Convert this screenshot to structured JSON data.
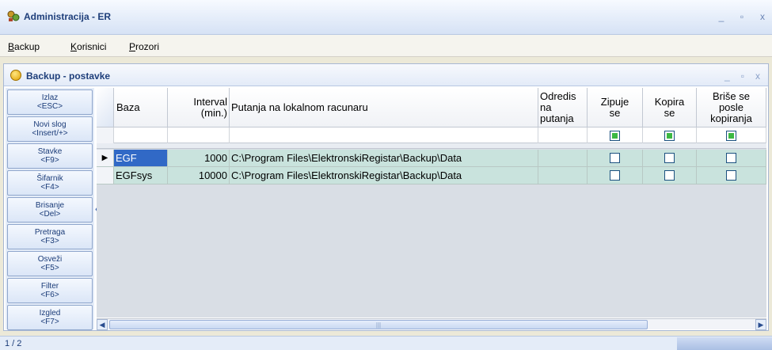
{
  "app": {
    "title": "Administracija - ER",
    "controls": {
      "minimize": "_",
      "maximize": "▫",
      "close": "x"
    }
  },
  "menu": {
    "items": [
      {
        "mnemonic": "B",
        "rest": "ackup"
      },
      {
        "mnemonic": "K",
        "rest": "orisnici"
      },
      {
        "mnemonic": "P",
        "rest": "rozori"
      }
    ]
  },
  "window": {
    "title": "Backup - postavke",
    "controls": {
      "minimize": "_",
      "maximize": "▫",
      "close": "x"
    }
  },
  "sidebar": {
    "buttons": [
      {
        "line1": "Izlaz",
        "line2": "<ESC>"
      },
      {
        "line1": "Novi slog",
        "line2": "<Insert/+>"
      },
      {
        "line1": "Stavke",
        "line2": "<F9>"
      },
      {
        "line1": "Šifarnik",
        "line2": "<F4>"
      },
      {
        "line1": "Brisanje",
        "line2": "<Del>"
      },
      {
        "line1": "Pretraga",
        "line2": "<F3>"
      },
      {
        "line1": "Osveži",
        "line2": "<F5>"
      },
      {
        "line1": "Filter",
        "line2": "<F6>"
      },
      {
        "line1": "Izgled",
        "line2": "<F7>"
      }
    ],
    "collapse_icon": "chevron-left-icon"
  },
  "grid": {
    "columns": [
      {
        "label": "Baza"
      },
      {
        "label": "Interval\n(min.)"
      },
      {
        "label": "Putanja na lokalnom racunaru"
      },
      {
        "label": "Odredis\nna\nputanja"
      },
      {
        "label": "Zipuje\nse"
      },
      {
        "label": "Kopira\nse"
      },
      {
        "label": "Briše se\nposle\nkopiranja"
      }
    ],
    "rows": [
      {
        "baza": "EGF",
        "interval": "1000",
        "putanja": "C:\\Program Files\\ElektronskiRegistar\\Backup\\Data",
        "odrediste": "",
        "zipuje": false,
        "kopira": false,
        "brise": false,
        "current": true
      },
      {
        "baza": "EGFsys",
        "interval": "10000",
        "putanja": "C:\\Program Files\\ElektronskiRegistar\\Backup\\Data",
        "odrediste": "",
        "zipuje": false,
        "kopira": false,
        "brise": false,
        "current": false
      }
    ],
    "row_indicator": "▶",
    "scroll_grip": "|||"
  },
  "status": {
    "record": "1 / 2"
  },
  "colors": {
    "accent": "#3169c6",
    "row_bg": "#c9e3dd",
    "title_text": "#1e3e7a"
  }
}
